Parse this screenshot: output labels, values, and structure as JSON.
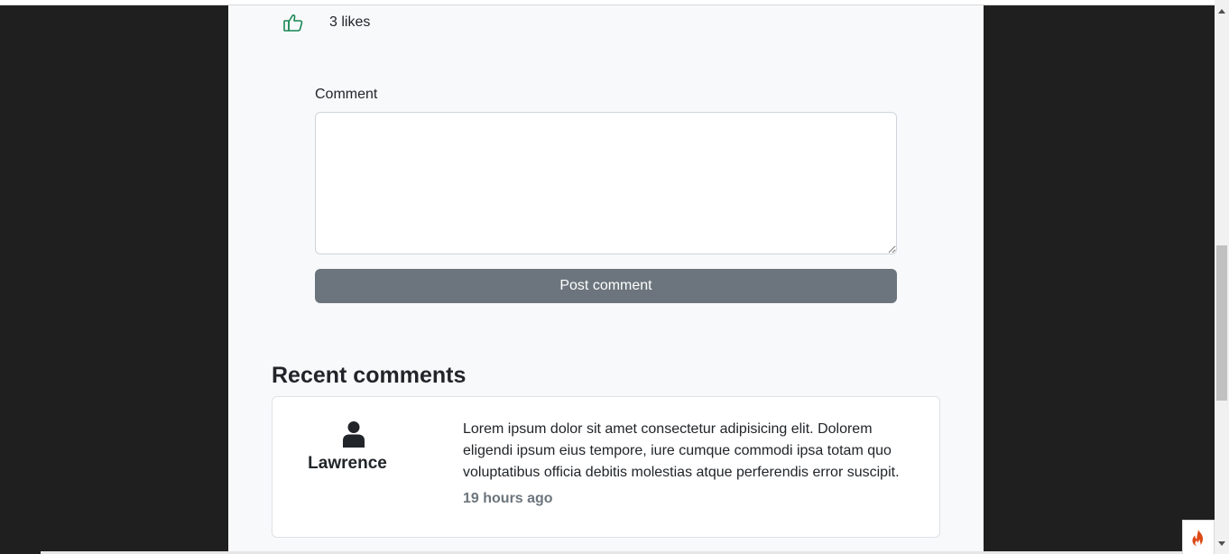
{
  "post": {
    "likes_label": "3 likes",
    "like_icon": "thumbs-up-icon",
    "like_icon_color": "#198754"
  },
  "comment_form": {
    "label": "Comment",
    "value": "",
    "placeholder": "",
    "submit_label": "Post comment",
    "submit_color": "#6c757d"
  },
  "recent_comments": {
    "heading": "Recent comments",
    "items": [
      {
        "author": "Lawrence",
        "avatar_icon": "user-icon",
        "text": "Lorem ipsum dolor sit amet consectetur adipisicing elit. Dolorem eligendi ipsum eius tempore, iure cumque commodi ipsa totam quo voluptatibus officia debitis molestias atque perferendis error suscipit.",
        "time": "19 hours ago"
      }
    ]
  },
  "toolbar_badge": {
    "icon": "flame-icon",
    "color": "#dd4814"
  }
}
